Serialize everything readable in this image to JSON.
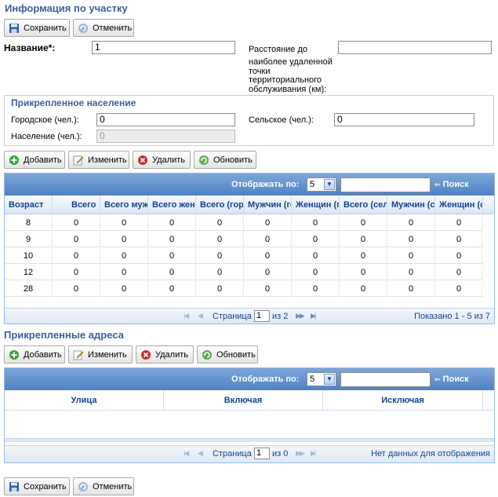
{
  "page": {
    "title": "Информация по участку",
    "save_label": "Сохранить",
    "cancel_label": "Отменить"
  },
  "form": {
    "name_label": "Название*:",
    "name_value": "1",
    "distance_label_1": "Расстояние до",
    "distance_label_2": "наиболее удаленной",
    "distance_label_3": "точки",
    "distance_label_4": "территориального",
    "distance_label_5": "обслуживания (км):",
    "distance_value": ""
  },
  "population": {
    "title": "Прикрепленное население",
    "urban_label": "Городское (чел.):",
    "urban_value": "0",
    "rural_label": "Сельское (чел.):",
    "rural_value": "0",
    "total_label": "Население (чел.):",
    "total_value": "0"
  },
  "toolbar1": {
    "add": "Добавить",
    "edit": "Изменить",
    "delete": "Удалить",
    "refresh": "Обновить"
  },
  "grid1": {
    "show_label": "Отображать по:",
    "page_size": "5",
    "search_label": "Поиск",
    "columns": [
      "Возраст",
      "Всего",
      "Всего мужчин",
      "Всего женщин",
      "Всего (городское)",
      "Мужчин (городское)",
      "Женщин (городское)",
      "Всего (сельское)",
      "Мужчин (сельское)",
      "Женщин (сельское)"
    ],
    "rows": [
      [
        "8",
        "0",
        "0",
        "0",
        "0",
        "0",
        "0",
        "0",
        "0",
        "0"
      ],
      [
        "9",
        "0",
        "0",
        "0",
        "0",
        "0",
        "0",
        "0",
        "0",
        "0"
      ],
      [
        "10",
        "0",
        "0",
        "0",
        "0",
        "0",
        "0",
        "0",
        "0",
        "0"
      ],
      [
        "12",
        "0",
        "0",
        "0",
        "0",
        "0",
        "0",
        "0",
        "0",
        "0"
      ],
      [
        "28",
        "0",
        "0",
        "0",
        "0",
        "0",
        "0",
        "0",
        "0",
        "0"
      ]
    ],
    "page_label": "Страница",
    "page_value": "1",
    "of_label": "из 2",
    "status": "Показано 1 - 5 из 7"
  },
  "addresses": {
    "title": "Прикрепленные адреса"
  },
  "toolbar2": {
    "add": "Добавить",
    "edit": "Изменить",
    "delete": "Удалить",
    "refresh": "Обновить"
  },
  "grid2": {
    "show_label": "Отображать по:",
    "page_size": "5",
    "search_label": "Поиск",
    "columns": [
      "Улица",
      "Включая",
      "Исключая"
    ],
    "page_label": "Страница",
    "page_value": "1",
    "of_label": "из 0",
    "status": "Нет данных для отображения"
  },
  "colors": {
    "title": "#3a5f9e",
    "grid_header": "#15428b",
    "toolbar_top": "#7da6d8",
    "toolbar_bottom": "#4f82c4"
  }
}
